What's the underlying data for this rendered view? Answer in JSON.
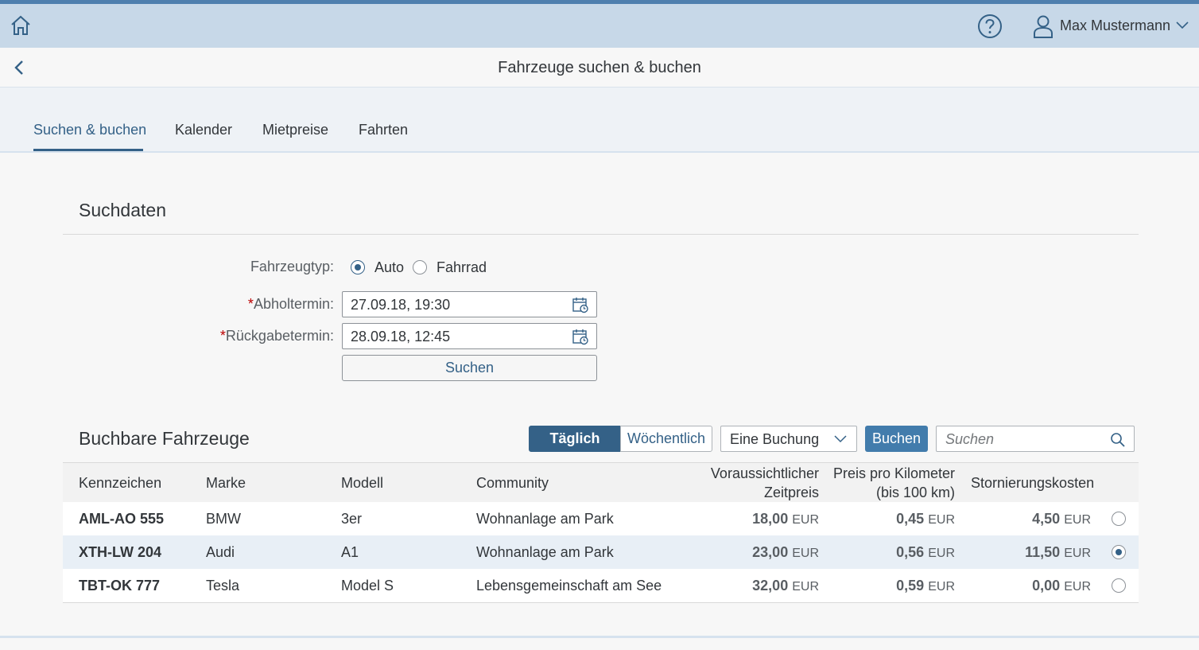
{
  "shell": {
    "user_name": "Max Mustermann"
  },
  "page": {
    "title": "Fahrzeuge suchen & buchen"
  },
  "tabs": [
    {
      "label": "Suchen & buchen",
      "active": true
    },
    {
      "label": "Kalender",
      "active": false
    },
    {
      "label": "Mietpreise",
      "active": false
    },
    {
      "label": "Fahrten",
      "active": false
    }
  ],
  "search_section": {
    "title": "Suchdaten",
    "vehicle_type_label": "Fahrzeugtyp:",
    "vehicle_type_options": [
      {
        "label": "Auto",
        "selected": true
      },
      {
        "label": "Fahrrad",
        "selected": false
      }
    ],
    "pickup_label": "Abholtermin:",
    "pickup_value": "27.09.18, 19:30",
    "return_label": "Rückgabetermin:",
    "return_value": "28.09.18, 12:45",
    "search_button": "Suchen"
  },
  "results_section": {
    "title": "Buchbare Fahrzeuge",
    "segment_options": [
      {
        "label": "Täglich",
        "selected": true
      },
      {
        "label": "Wöchentlich",
        "selected": false
      }
    ],
    "booking_select_value": "Eine Buchung",
    "book_button": "Buchen",
    "search_placeholder": "Suchen",
    "columns": {
      "plate": "Kennzeichen",
      "brand": "Marke",
      "model": "Modell",
      "community": "Community",
      "time_price_1": "Voraussichtlicher",
      "time_price_2": "Zeitpreis",
      "km_price_1": "Preis pro Kilometer",
      "km_price_2": "(bis 100 km)",
      "cancel": "Stornierungskosten"
    },
    "currency": "EUR",
    "rows": [
      {
        "plate": "AML-AO 555",
        "brand": "BMW",
        "model": "3er",
        "community": "Wohnanlage am Park",
        "time_price": "18,00",
        "km_price": "0,45",
        "cancel_cost": "4,50",
        "selected": false
      },
      {
        "plate": "XTH-LW 204",
        "brand": "Audi",
        "model": "A1",
        "community": "Wohnanlage am Park",
        "time_price": "23,00",
        "km_price": "0,56",
        "cancel_cost": "11,50",
        "selected": true
      },
      {
        "plate": "TBT-OK 777",
        "brand": "Tesla",
        "model": "Model S",
        "community": "Lebensgemeinschaft am See",
        "time_price": "32,00",
        "km_price": "0,59",
        "cancel_cost": "0,00",
        "selected": false
      }
    ]
  },
  "colors": {
    "brand_blue": "#346187",
    "accent_button": "#427cac",
    "shell_bg": "#c7d8e8",
    "required": "#bb0000"
  },
  "icons": [
    "home-icon",
    "help-icon",
    "user-icon",
    "chevron-down-icon",
    "back-icon",
    "calendar-icon",
    "search-icon"
  ]
}
